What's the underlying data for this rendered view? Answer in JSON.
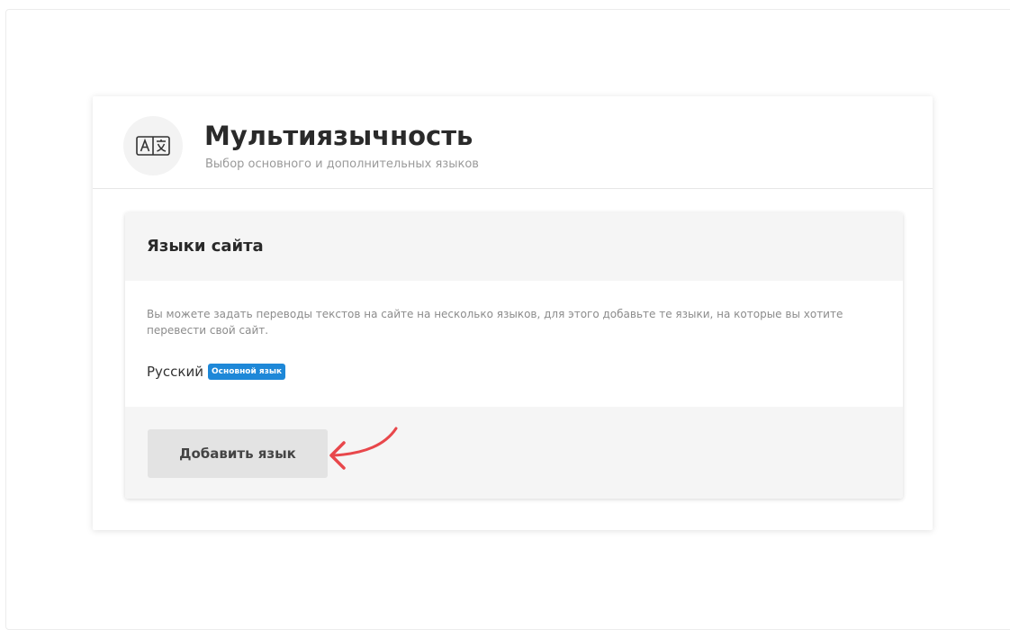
{
  "header": {
    "title": "Мультиязычность",
    "subtitle": "Выбор основного и дополнительных языков",
    "icon": "translate-icon"
  },
  "languages_panel": {
    "title": "Языки сайта",
    "description": "Вы можете задать переводы текстов на сайте на несколько языков, для этого добавьте те языки, на которые вы хотите перевести свой сайт.",
    "languages": [
      {
        "name": "Русский",
        "badge": "Основной язык"
      }
    ],
    "add_button_label": "Добавить язык"
  },
  "colors": {
    "badge_background": "#1e88d8",
    "annotation_arrow": "#e8474b",
    "button_background": "#e3e3e3"
  }
}
